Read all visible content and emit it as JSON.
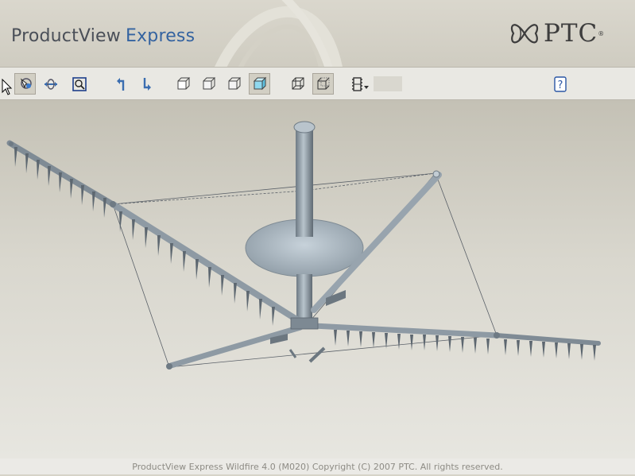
{
  "app": {
    "title_product": "ProductView",
    "title_express": "Express",
    "vendor_logo": "PTC",
    "vendor_logo_mark": "®"
  },
  "toolbar": {
    "buttons": [
      {
        "icon": "select-icon",
        "active": true
      },
      {
        "icon": "pan-rotate-icon",
        "active": false
      },
      {
        "icon": "zoom-window-icon",
        "active": false
      },
      {
        "icon": "undo-view-icon",
        "active": false
      },
      {
        "icon": "redo-view-icon",
        "active": false
      },
      {
        "icon": "view-front-icon",
        "active": false
      },
      {
        "icon": "view-iso-icon",
        "active": false
      },
      {
        "icon": "view-right-icon",
        "active": false
      },
      {
        "icon": "shaded-render-icon",
        "active": true
      },
      {
        "icon": "wireframe-icon",
        "active": false
      },
      {
        "icon": "hidden-line-icon",
        "active": true
      },
      {
        "icon": "animation-filmstrip-icon",
        "active": false
      },
      {
        "icon": "help-icon",
        "active": false
      }
    ],
    "help_label": "?"
  },
  "footer": {
    "copyright": "ProductView Express Wildfire 4.0 (M020) Copyright (C) 2007 PTC.  All rights reserved."
  },
  "colors": {
    "accent_blue": "#3463a0",
    "model_steel": "#9aa7b1"
  }
}
